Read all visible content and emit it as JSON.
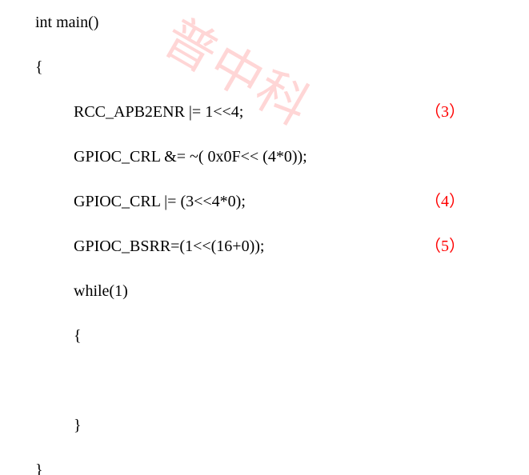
{
  "watermark": "普中科",
  "code": {
    "l1": "int main()",
    "l2": "{",
    "l3": "RCC_APB2ENR |= 1<<4;",
    "l4": "GPIOC_CRL &= ~( 0x0F<< (4*0));",
    "l5": "GPIOC_CRL |= (3<<4*0);",
    "l6": "GPIOC_BSRR=(1<<(16+0));",
    "l7": "while(1)",
    "l8": "{",
    "l9": "",
    "l10": "}",
    "l11": "}"
  },
  "annotations": {
    "a3": "（3）",
    "a4": "（4）",
    "a5": "（5）"
  }
}
